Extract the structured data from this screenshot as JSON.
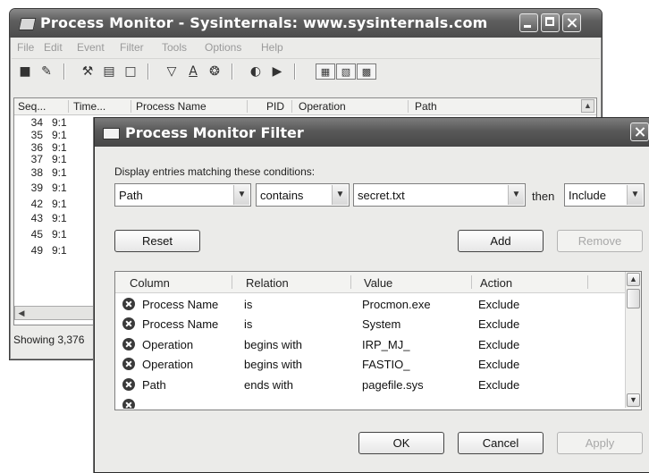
{
  "main_window": {
    "title": "Process Monitor - Sysinternals: www.sysinternals.com",
    "menu": [
      "File",
      "Edit",
      "Event",
      "Filter",
      "Tools",
      "Options",
      "Help"
    ],
    "toolbar_icons": [
      "save-icon",
      "open-icon",
      "capture-icon",
      "autoscroll-icon",
      "clear-icon",
      "filter-icon",
      "highlight-icon",
      "network-icon",
      "find-icon",
      "jump-icon",
      "registry-icon",
      "filesystem-icon",
      "process-icon"
    ],
    "columns": [
      "Seq...",
      "Time...",
      "Process Name",
      "PID",
      "Operation",
      "Path"
    ],
    "rows": [
      {
        "seq": "34",
        "time": "9:1"
      },
      {
        "seq": "35",
        "time": "9:1"
      },
      {
        "seq": "36",
        "time": "9:1"
      },
      {
        "seq": "37",
        "time": "9:1"
      },
      {
        "seq": "38",
        "time": "9:1"
      },
      {
        "seq": "39",
        "time": "9:1"
      },
      {
        "seq": "42",
        "time": "9:1"
      },
      {
        "seq": "43",
        "time": "9:1"
      },
      {
        "seq": "45",
        "time": "9:1"
      },
      {
        "seq": "49",
        "time": "9:1"
      }
    ],
    "status": "Showing 3,376"
  },
  "dialog": {
    "title": "Process Monitor Filter",
    "prompt": "Display entries matching these conditions:",
    "column_value": "Path",
    "relation_value": "contains",
    "value_text": "secret.txt",
    "then_label": "then",
    "action_value": "Include",
    "buttons": {
      "reset": "Reset",
      "add": "Add",
      "remove": "Remove",
      "ok": "OK",
      "cancel": "Cancel",
      "apply": "Apply"
    },
    "rule_columns": [
      "Column",
      "Relation",
      "Value",
      "Action"
    ],
    "rules": [
      {
        "column": "Process Name",
        "relation": "is",
        "value": "Procmon.exe",
        "action": "Exclude"
      },
      {
        "column": "Process Name",
        "relation": "is",
        "value": "System",
        "action": "Exclude"
      },
      {
        "column": "Operation",
        "relation": "begins with",
        "value": "IRP_MJ_",
        "action": "Exclude"
      },
      {
        "column": "Operation",
        "relation": "begins with",
        "value": "FASTIO_",
        "action": "Exclude"
      },
      {
        "column": "Path",
        "relation": "ends with",
        "value": "pagefile.sys",
        "action": "Exclude"
      }
    ]
  }
}
